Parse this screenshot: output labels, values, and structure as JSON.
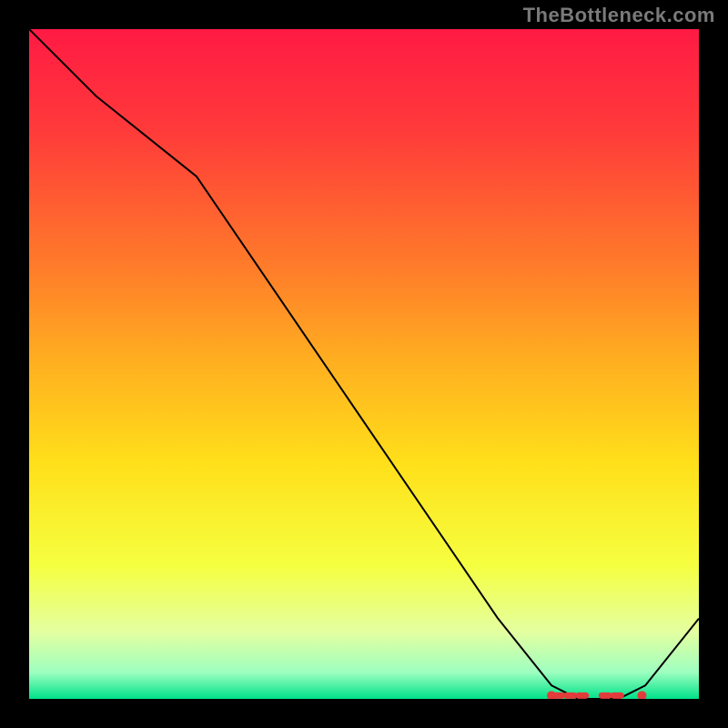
{
  "watermark": "TheBottleneck.com",
  "chart_data": {
    "type": "line",
    "title": "",
    "xlabel": "",
    "ylabel": "",
    "xlim": [
      0,
      100
    ],
    "ylim": [
      0,
      100
    ],
    "grid": false,
    "legend": false,
    "background_gradient": {
      "stops": [
        {
          "offset": 0.0,
          "color": "#ff1a44"
        },
        {
          "offset": 0.15,
          "color": "#ff3a3a"
        },
        {
          "offset": 0.35,
          "color": "#ff7a2a"
        },
        {
          "offset": 0.5,
          "color": "#ffb020"
        },
        {
          "offset": 0.65,
          "color": "#ffe01a"
        },
        {
          "offset": 0.8,
          "color": "#f5ff40"
        },
        {
          "offset": 0.9,
          "color": "#e4ffa0"
        },
        {
          "offset": 0.96,
          "color": "#9effc0"
        },
        {
          "offset": 1.0,
          "color": "#00e28a"
        }
      ]
    },
    "series": [
      {
        "name": "bottleneck-curve",
        "color": "#000000",
        "width": 2,
        "x": [
          0,
          10,
          25,
          40,
          55,
          70,
          78,
          82,
          88,
          92,
          100
        ],
        "y": [
          100,
          90,
          78,
          56,
          34,
          12,
          2,
          0,
          0,
          2,
          12
        ]
      }
    ],
    "markers": {
      "name": "highlighted-range",
      "color": "#e23b3b",
      "y": 0.5,
      "x": [
        78,
        79.5,
        81,
        82.5,
        84,
        85.5,
        87,
        88.5,
        90,
        91.5
      ],
      "dash_clusters": [
        {
          "start": 78.5,
          "end": 83.5
        },
        {
          "start": 85.5,
          "end": 88.5
        }
      ],
      "end_dots": [
        78,
        91.5
      ]
    }
  }
}
